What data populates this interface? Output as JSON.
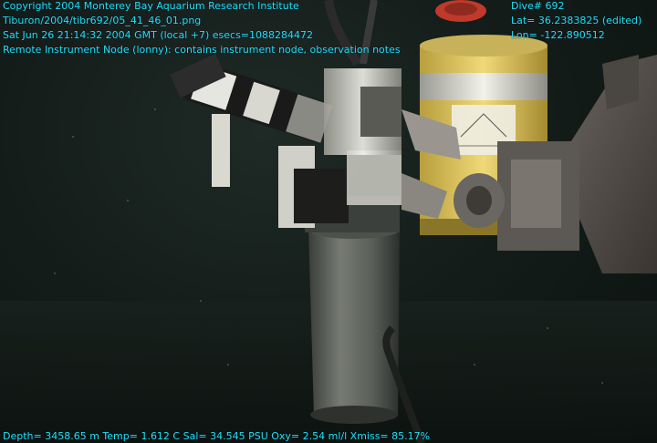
{
  "overlay": {
    "top_left": [
      "Copyright 2004 Monterey Bay Aquarium Research Institute",
      "Tiburon/2004/tibr692/05_41_46_01.png",
      "Sat Jun 26 21:14:32 2004 GMT (local +7)  esecs=1088284472",
      "Remote Instrument Node (lonny): contains instrument node, observation notes"
    ],
    "top_right": [
      "Dive# 692",
      "Lat= 36.2383825 (edited)",
      "Lon= -122.890512"
    ],
    "bottom": "Depth= 3458.65 m  Temp= 1.612 C  Sal= 34.545 PSU  Oxy= 2.54 ml/l  Xmiss= 85.17%"
  },
  "scene": {
    "subject": "Deep-sea remote instrument node on a pole, with ROV manipulator arm gripping the instrument housing",
    "colors": {
      "water": "#141d1a",
      "seafloor": "#0e1511",
      "pole": "#5a5e58",
      "housing_yellow": "#e8d06a",
      "housing_white": "#e8e8e0",
      "overlay_text": "#22e0f0"
    }
  }
}
